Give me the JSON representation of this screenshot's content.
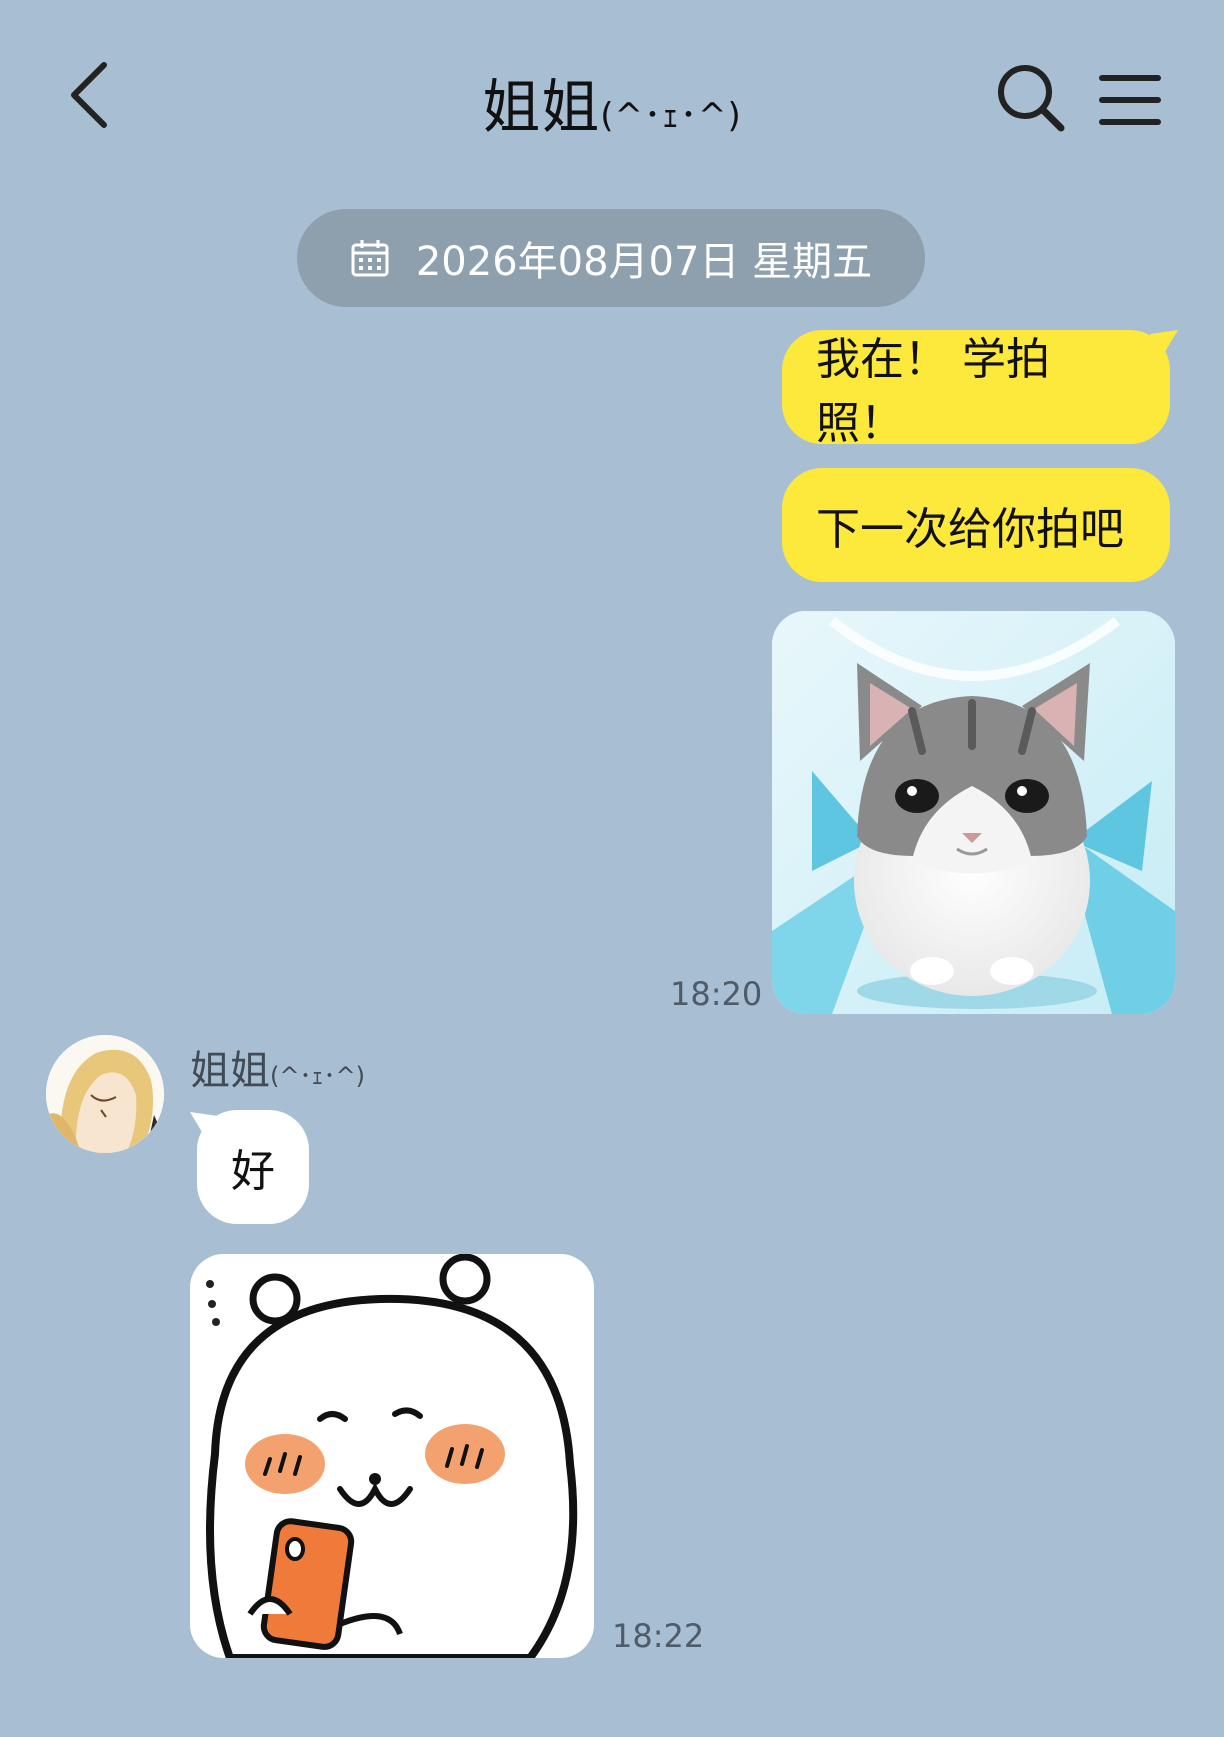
{
  "header": {
    "title": "姐姐",
    "title_emoticon": "(^･ｪ･^)",
    "back_icon": "chevron-left-icon",
    "search_icon": "search-icon",
    "menu_icon": "hamburger-menu-icon"
  },
  "date_divider": {
    "icon": "calendar-icon",
    "text": "2026年08月07日 星期五"
  },
  "messages": [
    {
      "direction": "outgoing",
      "type": "text",
      "text": "我在！ 学拍照！"
    },
    {
      "direction": "outgoing",
      "type": "text",
      "text": "下一次给你拍吧"
    },
    {
      "direction": "outgoing",
      "type": "sticker",
      "sticker": "crying-cat-sticker",
      "time": "18:20"
    },
    {
      "direction": "incoming",
      "sender": "姐姐",
      "sender_emoticon": "(^･ｪ･^)",
      "type": "text",
      "text": "好"
    },
    {
      "direction": "incoming",
      "type": "sticker",
      "sticker": "bear-with-phone-sticker",
      "time": "18:22"
    }
  ],
  "colors": {
    "background": "#a8bed2",
    "outgoing_bubble": "#fde93c",
    "incoming_bubble": "#ffffff",
    "date_pill": "#8e9fae"
  }
}
